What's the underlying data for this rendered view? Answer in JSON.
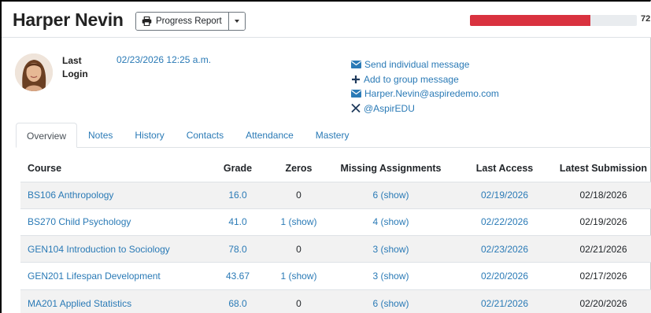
{
  "header": {
    "student_name": "Harper Nevin",
    "report_button_label": "Progress Report",
    "progress": {
      "value": 72,
      "label": "72",
      "color": "#d9323f"
    }
  },
  "profile": {
    "login_label_line1": "Last",
    "login_label_line2": "Login",
    "last_login": "02/23/2026 12:25 a.m.",
    "actions": [
      {
        "icon": "envelope-icon",
        "label": "Send individual message"
      },
      {
        "icon": "plus-icon",
        "label": "Add to group message"
      },
      {
        "icon": "envelope-icon",
        "label": "Harper.Nevin@aspiredemo.com"
      },
      {
        "icon": "x-logo-icon",
        "label": "@AspirEDU"
      }
    ]
  },
  "tabs": [
    "Overview",
    "Notes",
    "History",
    "Contacts",
    "Attendance",
    "Mastery"
  ],
  "active_tab": "Overview",
  "table": {
    "headers": [
      "Course",
      "Grade",
      "Zeros",
      "Missing Assignments",
      "Last Access",
      "Latest Submission"
    ],
    "rows": [
      {
        "course": "BS106 Anthropology",
        "grade": "16.0",
        "zeros": "0",
        "missing": "6 (show)",
        "last_access": "02/19/2026",
        "latest_submission": "02/18/2026"
      },
      {
        "course": "BS270 Child Psychology",
        "grade": "41.0",
        "zeros": "1 (show)",
        "missing": "4 (show)",
        "last_access": "02/22/2026",
        "latest_submission": "02/19/2026"
      },
      {
        "course": "GEN104 Introduction to Sociology",
        "grade": "78.0",
        "zeros": "0",
        "missing": "3 (show)",
        "last_access": "02/23/2026",
        "latest_submission": "02/21/2026"
      },
      {
        "course": "GEN201 Lifespan Development",
        "grade": "43.67",
        "zeros": "1 (show)",
        "missing": "3 (show)",
        "last_access": "02/20/2026",
        "latest_submission": "02/17/2026"
      },
      {
        "course": "MA201 Applied Statistics",
        "grade": "68.0",
        "zeros": "0",
        "missing": "6 (show)",
        "last_access": "02/21/2026",
        "latest_submission": "02/20/2026"
      }
    ]
  }
}
